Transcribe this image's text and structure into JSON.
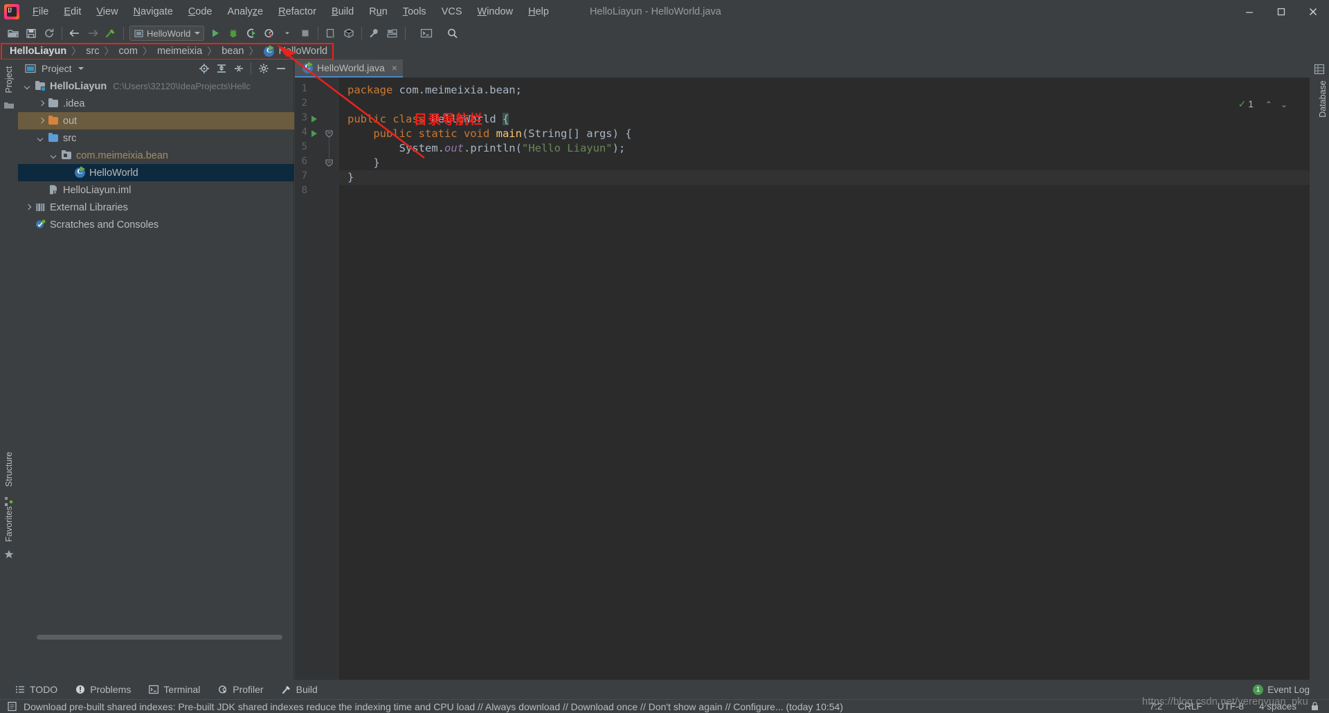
{
  "window": {
    "title": "HelloLiayun - HelloWorld.java",
    "controls": [
      "minimize",
      "maximize",
      "close"
    ]
  },
  "menu": {
    "items": [
      {
        "label": "File",
        "mnemonic": "F"
      },
      {
        "label": "Edit",
        "mnemonic": "E"
      },
      {
        "label": "View",
        "mnemonic": "V"
      },
      {
        "label": "Navigate",
        "mnemonic": "N"
      },
      {
        "label": "Code",
        "mnemonic": "C"
      },
      {
        "label": "Analyze",
        "mnemonic": "z"
      },
      {
        "label": "Refactor",
        "mnemonic": "R"
      },
      {
        "label": "Build",
        "mnemonic": "B"
      },
      {
        "label": "Run",
        "mnemonic": "u"
      },
      {
        "label": "Tools",
        "mnemonic": "T"
      },
      {
        "label": "VCS",
        "mnemonic": ""
      },
      {
        "label": "Window",
        "mnemonic": "W"
      },
      {
        "label": "Help",
        "mnemonic": "H"
      }
    ]
  },
  "toolbar": {
    "icons": [
      "open-folder-icon",
      "save-icon",
      "sync-icon",
      "back-arrow-icon",
      "forward-arrow-icon",
      "build-hammer-icon"
    ],
    "run_config": "HelloWorld",
    "run_icons": [
      "run-icon",
      "debug-icon",
      "run-coverage-icon",
      "profile-icon",
      "stop-icon"
    ],
    "right_icons": [
      "update-project-icon",
      "package-icon",
      "settings-wrench-icon",
      "project-structure-icon",
      "terminal-icon",
      "search-icon"
    ]
  },
  "navbar": {
    "crumbs": [
      {
        "label": "HelloLiayun",
        "bold": true,
        "icon": ""
      },
      {
        "label": "src",
        "bold": false,
        "icon": ""
      },
      {
        "label": "com",
        "bold": false,
        "icon": ""
      },
      {
        "label": "meimeixia",
        "bold": false,
        "icon": ""
      },
      {
        "label": "bean",
        "bold": false,
        "icon": ""
      },
      {
        "label": "HelloWorld",
        "bold": false,
        "icon": "java-class-icon"
      }
    ],
    "separator": "〉",
    "highlight_color": "#e8231c"
  },
  "annotation": {
    "text": "目录导航栏",
    "color": "#e8231c"
  },
  "left_strip": {
    "top_label": "Project",
    "bottom_labels": [
      "Structure",
      "Favorites"
    ]
  },
  "right_strip": {
    "label": "Database"
  },
  "project_panel": {
    "title": "Project",
    "header_icons": [
      "locate-icon",
      "expand-all-icon",
      "collapse-all-icon",
      "settings-gear-icon",
      "hide-icon"
    ],
    "tree": [
      {
        "label": "HelloLiayun",
        "path": "C:\\Users\\32120\\IdeaProjects\\Hellc",
        "indent": 0,
        "arrow": "down",
        "icon": "module-folder-icon",
        "bold": true,
        "state": "normal"
      },
      {
        "label": ".idea",
        "path": "",
        "indent": 1,
        "arrow": "right",
        "icon": "folder-gray-icon",
        "bold": false,
        "state": "normal"
      },
      {
        "label": "out",
        "path": "",
        "indent": 1,
        "arrow": "right",
        "icon": "folder-orange-icon",
        "bold": false,
        "state": "highlighted"
      },
      {
        "label": "src",
        "path": "",
        "indent": 1,
        "arrow": "down",
        "icon": "folder-source-icon",
        "bold": false,
        "state": "normal"
      },
      {
        "label": "com.meimeixia.bean",
        "path": "",
        "indent": 2,
        "arrow": "down",
        "icon": "package-icon",
        "bold": false,
        "state": "package"
      },
      {
        "label": "HelloWorld",
        "path": "",
        "indent": 3,
        "arrow": "none",
        "icon": "java-class-icon",
        "bold": false,
        "state": "selected"
      },
      {
        "label": "HelloLiayun.iml",
        "path": "",
        "indent": 1,
        "arrow": "none",
        "icon": "iml-file-icon",
        "bold": false,
        "state": "normal"
      },
      {
        "label": "External Libraries",
        "path": "",
        "indent": 0,
        "arrow": "right",
        "icon": "libraries-icon",
        "bold": false,
        "state": "normal"
      },
      {
        "label": "Scratches and Consoles",
        "path": "",
        "indent": 0,
        "arrow": "none",
        "icon": "scratches-icon",
        "bold": false,
        "state": "normal"
      }
    ]
  },
  "editor": {
    "tab": {
      "label": "HelloWorld.java",
      "icon": "java-class-icon",
      "close": "×"
    },
    "inspection": {
      "check": "✓",
      "count": "1",
      "up": "⌃",
      "down": "⌄"
    },
    "lines": [
      {
        "num": "1",
        "run_marker": false,
        "fold": false,
        "tokens": [
          {
            "t": "package ",
            "c": "k"
          },
          {
            "t": "com.meimeixia.bean;",
            "c": "t"
          }
        ]
      },
      {
        "num": "2",
        "run_marker": false,
        "fold": false,
        "tokens": []
      },
      {
        "num": "3",
        "run_marker": true,
        "fold": false,
        "tokens": [
          {
            "t": "public class ",
            "c": "k"
          },
          {
            "t": "HelloWorld ",
            "c": "cls"
          },
          {
            "t": "{",
            "c": "cursor"
          }
        ]
      },
      {
        "num": "4",
        "run_marker": true,
        "fold": true,
        "tokens": [
          {
            "t": "    ",
            "c": "t"
          },
          {
            "t": "public static void ",
            "c": "k"
          },
          {
            "t": "main",
            "c": "mth"
          },
          {
            "t": "(String[] args) {",
            "c": "t"
          }
        ]
      },
      {
        "num": "5",
        "run_marker": false,
        "fold": false,
        "tokens": [
          {
            "t": "        System.",
            "c": "t"
          },
          {
            "t": "out",
            "c": "fld"
          },
          {
            "t": ".println(",
            "c": "t"
          },
          {
            "t": "\"Hello Liayun\"",
            "c": "str"
          },
          {
            "t": ");",
            "c": "t"
          }
        ]
      },
      {
        "num": "6",
        "run_marker": false,
        "fold": true,
        "tokens": [
          {
            "t": "    }",
            "c": "t"
          }
        ]
      },
      {
        "num": "7",
        "run_marker": false,
        "fold": false,
        "current": true,
        "tokens": [
          {
            "t": "}",
            "c": "t"
          }
        ]
      },
      {
        "num": "8",
        "run_marker": false,
        "fold": false,
        "tokens": []
      }
    ]
  },
  "status_buttons": [
    {
      "label": "TODO",
      "icon": "todo-list-icon"
    },
    {
      "label": "Problems",
      "icon": "problems-warning-icon"
    },
    {
      "label": "Terminal",
      "icon": "terminal-icon"
    },
    {
      "label": "Profiler",
      "icon": "profiler-icon"
    },
    {
      "label": "Build",
      "icon": "build-hammer-icon"
    }
  ],
  "event_log": {
    "badge": "1",
    "label": "Event Log"
  },
  "notification": {
    "icon": "info-document-icon",
    "text": "Download pre-built shared indexes: Pre-built JDK shared indexes reduce the indexing time and CPU load // Always download // Download once // Don't show again // Configure... (today 10:54)"
  },
  "status_right": {
    "caret": "7:2",
    "line_sep": "CRLF",
    "encoding": "UTF-8",
    "indent": "4 spaces",
    "lock": "🔒"
  },
  "watermark": "https://blog.csdn.net/yerenyuan_pku"
}
